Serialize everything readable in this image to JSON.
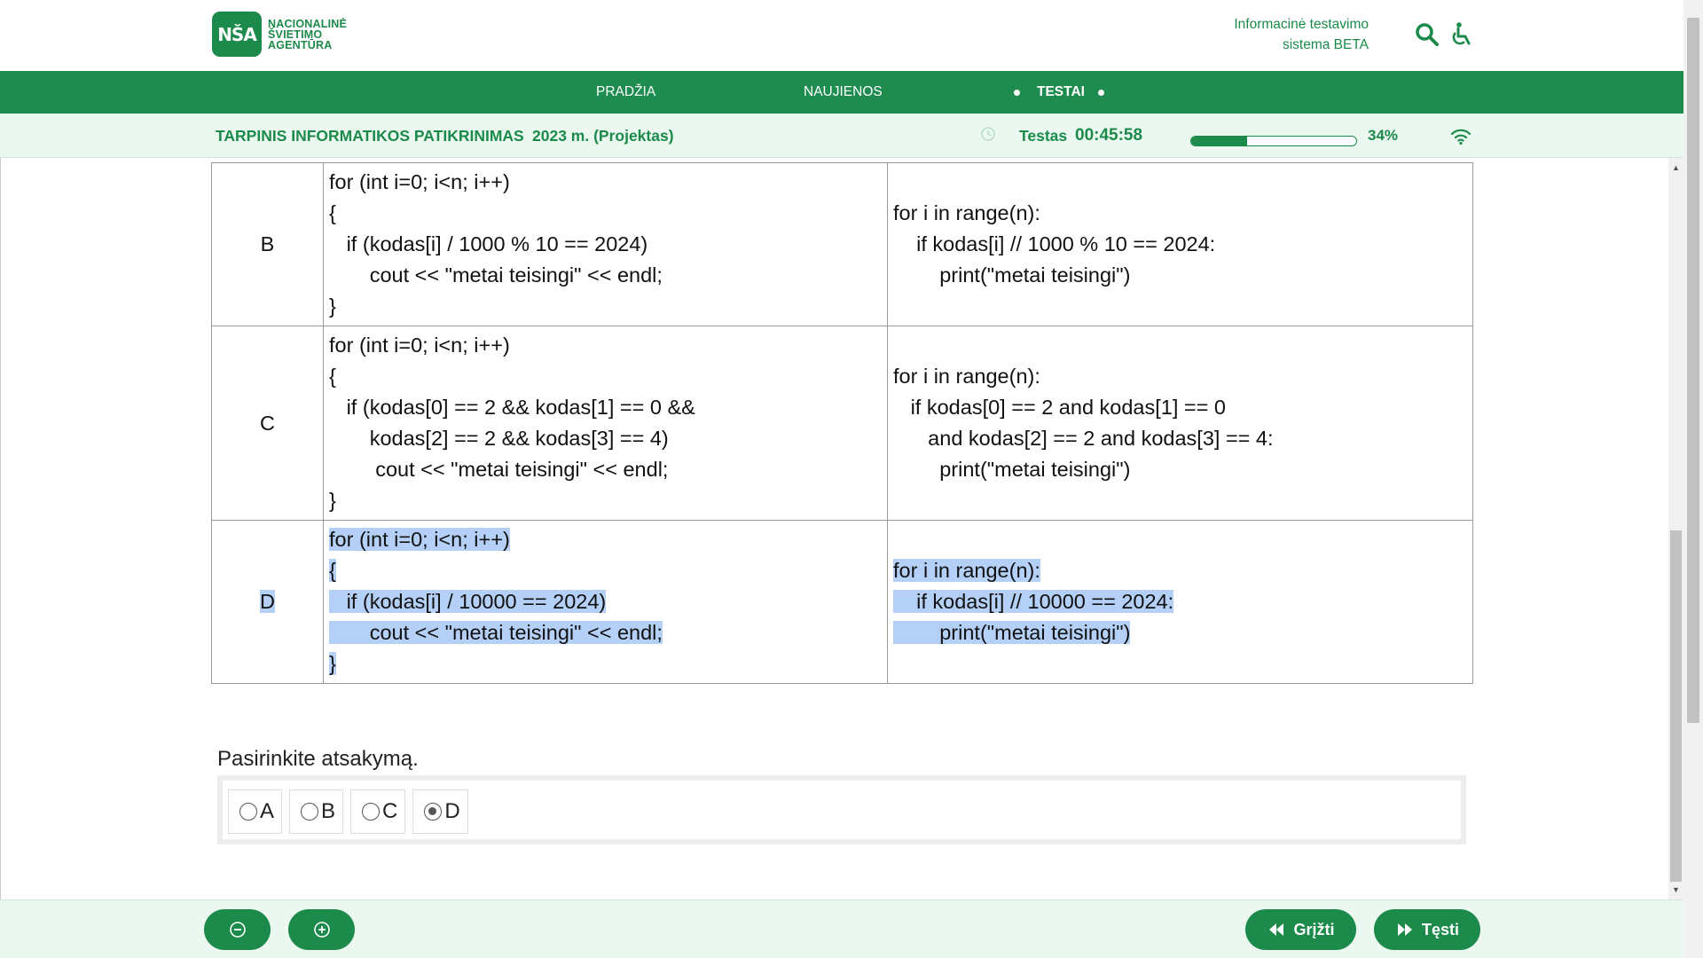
{
  "header": {
    "logo_mark": "NŠA",
    "logo_lines": [
      "NACIONALINĖ",
      "ŠVIETIMO",
      "AGENTŪRA"
    ],
    "system_name_line1": "Informacinė testavimo",
    "system_name_line2": "sistema BETA",
    "icons": [
      "search-icon",
      "accessibility-icon"
    ]
  },
  "nav": {
    "items": [
      {
        "label": "PRADŽIA"
      },
      {
        "label": "NAUJIENOS"
      },
      {
        "label": "TESTAI",
        "active": true
      }
    ]
  },
  "status": {
    "test_title": "TARPINIS INFORMATIKOS PATIKRINIMAS",
    "year": "2023 m. (Projektas)",
    "time_label": "Testas",
    "time": "00:45:58",
    "progress_fraction": 0.34,
    "progress_text": "34%",
    "icons": [
      "clock-icon",
      "wifi-icon"
    ]
  },
  "question_table": {
    "rows": [
      {
        "label": "B",
        "cpp": [
          "for (int i=0; i<n; i++)",
          "{",
          "   if (kodas[i] / 1000 % 10 == 2024)",
          "       cout << \"metai teisingi\" << endl;",
          "}"
        ],
        "python": [
          "for i in range(n):",
          "    if kodas[i] // 1000 % 10 == 2024:",
          "        print(\"metai teisingi\")"
        ]
      },
      {
        "label": "C",
        "cpp": [
          "for (int i=0; i<n; i++)",
          "{",
          "   if (kodas[0] == 2 && kodas[1] == 0 &&",
          "       kodas[2] == 2 && kodas[3] == 4)",
          "        cout << \"metai teisingi\" << endl;",
          "}"
        ],
        "python": [
          "for i in range(n):",
          "   if kodas[0] == 2 and kodas[1] == 0",
          "      and kodas[2] == 2 and kodas[3] == 4:",
          "        print(\"metai teisingi\")"
        ]
      },
      {
        "label": "D",
        "cpp": [
          "for (int i=0; i<n; i++)",
          "{",
          "   if (kodas[i] / 10000 == 2024)",
          "       cout << \"metai teisingi\" << endl;",
          "}"
        ],
        "python": [
          "for i in range(n):",
          "    if kodas[i] // 10000 == 2024:",
          "        print(\"metai teisingi\")"
        ],
        "selected_text": true
      }
    ]
  },
  "answer": {
    "prompt": "Pasirinkite atsakymą.",
    "options": [
      {
        "label": "A",
        "checked": false
      },
      {
        "label": "B",
        "checked": false
      },
      {
        "label": "C",
        "checked": false
      },
      {
        "label": "D",
        "checked": true
      }
    ]
  },
  "footer": {
    "zoom_out_icon": "zoom-out-icon",
    "zoom_in_icon": "zoom-in-icon",
    "back_label": "Grįžti",
    "next_label": "Tęsti"
  },
  "colors": {
    "brand_green": "#1b8a4a",
    "nav_green": "#1e8c4e",
    "status_bg": "#eaf8ef",
    "selection": "#b4d0f7"
  }
}
